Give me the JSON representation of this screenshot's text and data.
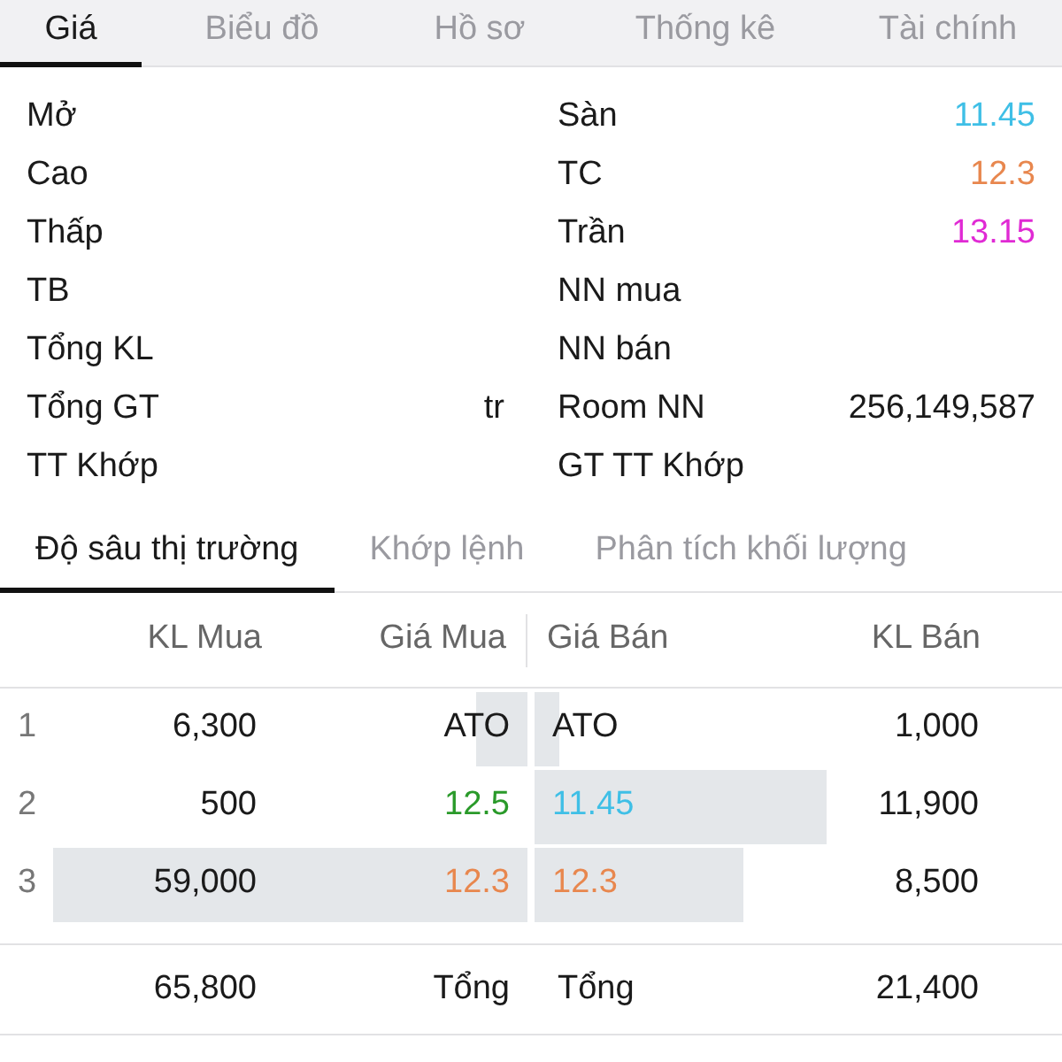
{
  "tabs": [
    {
      "label": "Giá",
      "selected": true
    },
    {
      "label": "Biểu đồ",
      "selected": false
    },
    {
      "label": "Hồ sơ",
      "selected": false
    },
    {
      "label": "Thống kê",
      "selected": false
    },
    {
      "label": "Tài chính",
      "selected": false
    }
  ],
  "info_left": [
    {
      "label": "Mở"
    },
    {
      "label": "Cao"
    },
    {
      "label": "Thấp"
    },
    {
      "label": "TB"
    },
    {
      "label": "Tổng KL"
    },
    {
      "label": "Tổng GT",
      "value": "tr"
    },
    {
      "label": "TT Khớp"
    }
  ],
  "info_right": [
    {
      "label": "Sàn",
      "value": "11.45",
      "color": "#3fbfe6"
    },
    {
      "label": "TC",
      "value": "12.3",
      "color": "#e8874e"
    },
    {
      "label": "Trần",
      "value": "13.15",
      "color": "#e02ad4"
    },
    {
      "label": "NN mua"
    },
    {
      "label": "NN bán"
    },
    {
      "label": "Room NN",
      "value": "256,149,587"
    },
    {
      "label": "GT TT Khớp"
    }
  ],
  "depth_tabs": [
    {
      "label": "Độ sâu thị trường",
      "selected": true
    },
    {
      "label": "Khớp lệnh",
      "selected": false
    },
    {
      "label": "Phân tích khối lượng",
      "selected": false
    }
  ],
  "table": {
    "columns": [
      "KL Mua",
      "Giá Mua",
      "Giá Bán",
      "KL Bán"
    ],
    "rows": [
      {
        "index": "1",
        "buy": {
          "volume": "6,300",
          "price": "ATO"
        },
        "sell": {
          "price": "ATO",
          "volume": "1,000"
        }
      },
      {
        "index": "2",
        "buy": {
          "volume": "500",
          "price": "12.5",
          "color": "#2a9a2a"
        },
        "sell": {
          "price": "11.45",
          "color": "#3fbfe6",
          "volume": "11,900"
        }
      },
      {
        "index": "3",
        "buy": {
          "volume": "59,000",
          "price": "12.3",
          "color": "#e8874e"
        },
        "sell": {
          "price": "12.3",
          "color": "#e8874e",
          "volume": "8,500"
        }
      }
    ],
    "total": {
      "buy_volume": "65,800",
      "buy_label": "Tổng",
      "sell_label": "Tổng",
      "sell_volume": "21,400"
    }
  }
}
